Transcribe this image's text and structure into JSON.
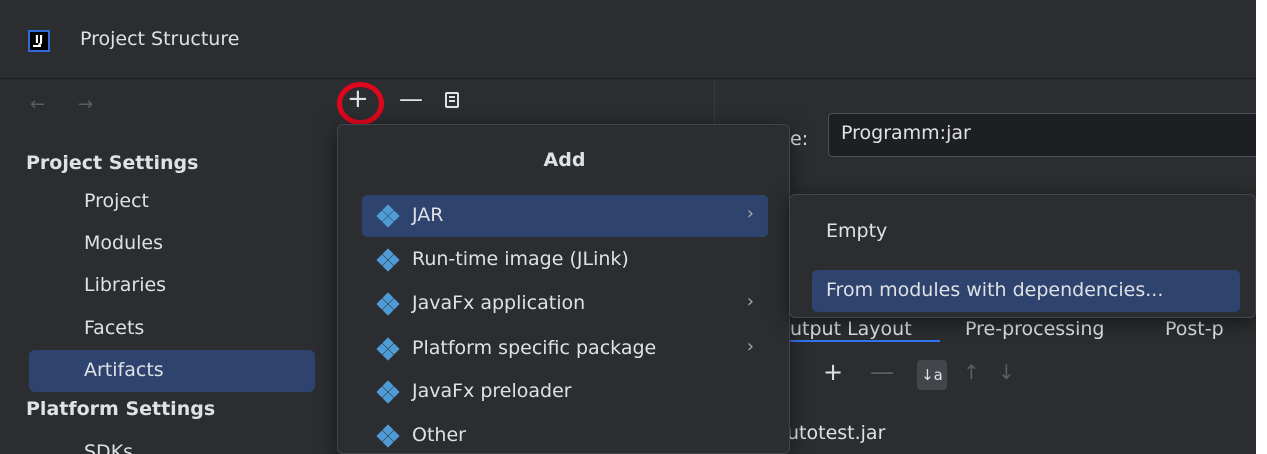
{
  "window": {
    "title": "Project Structure",
    "logo_text": "IJ"
  },
  "navigation": {
    "back": "←",
    "forward": "→"
  },
  "sidebar": {
    "project_settings_header": "Project Settings",
    "project_items": [
      {
        "label": "Project"
      },
      {
        "label": "Modules"
      },
      {
        "label": "Libraries"
      },
      {
        "label": "Facets"
      },
      {
        "label": "Artifacts",
        "selected": true
      }
    ],
    "platform_settings_header": "Platform Settings",
    "platform_items": [
      {
        "label": "SDKs"
      }
    ]
  },
  "toolbar": {
    "add": "+",
    "remove": "—"
  },
  "artifact": {
    "name_label_partial": "e:",
    "name_value": "Programm:jar",
    "tabs": [
      {
        "label": "utput Layout",
        "active": true
      },
      {
        "label": "Pre-processing"
      },
      {
        "label": "Post-p"
      }
    ],
    "add_icon": "+",
    "remove_icon": "—",
    "sort_icon": "↓a",
    "move_up": "↑",
    "move_down": "↓",
    "file": "utotest.jar"
  },
  "add_menu": {
    "title": "Add",
    "items": [
      {
        "label": "JAR",
        "submenu": true,
        "selected": true
      },
      {
        "label": "Run-time image (JLink)",
        "submenu": false
      },
      {
        "label": "JavaFx application",
        "submenu": true
      },
      {
        "label": "Platform specific package",
        "submenu": true
      },
      {
        "label": "JavaFx preloader",
        "submenu": false
      },
      {
        "label": "Other",
        "submenu": false
      }
    ],
    "chevron": "›"
  },
  "jar_submenu": {
    "items": [
      {
        "label": "Empty"
      },
      {
        "label": "From modules with dependencies...",
        "selected": true
      }
    ]
  },
  "colors": {
    "background": "#2b2d30",
    "selection": "#2e436e",
    "highlight_circle": "#e0061e",
    "icon_blue": "#4e9bd6"
  }
}
